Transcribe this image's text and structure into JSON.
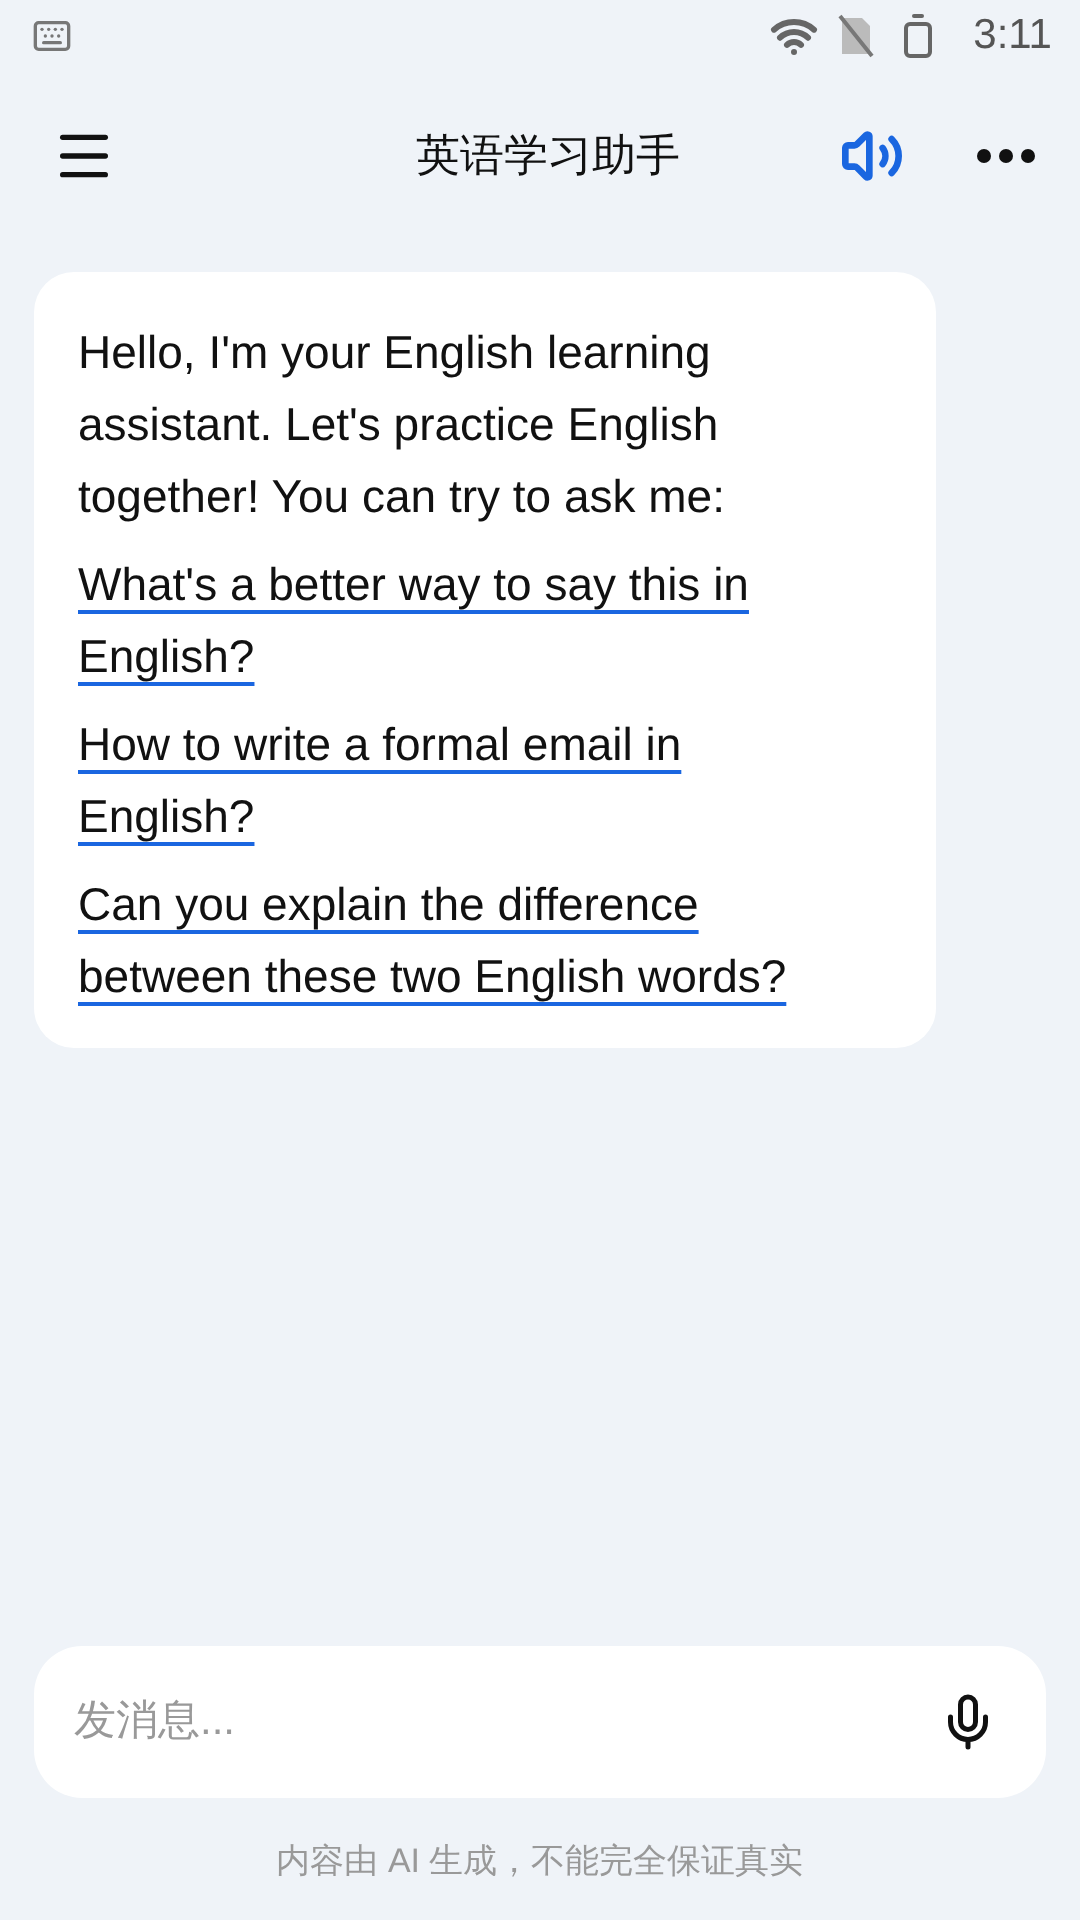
{
  "status_bar": {
    "time": "3:11"
  },
  "header": {
    "title": "英语学习助手"
  },
  "message": {
    "text": "Hello, I'm your English learning assistant. Let's practice English together! You can try to ask me:",
    "suggestions": [
      "What's a better way to say this in English?",
      "How to write a formal email in English?",
      "Can you explain the difference between these two English words?"
    ]
  },
  "composer": {
    "placeholder": "发消息..."
  },
  "footer": {
    "note": "内容由 AI 生成，不能完全保证真实"
  }
}
